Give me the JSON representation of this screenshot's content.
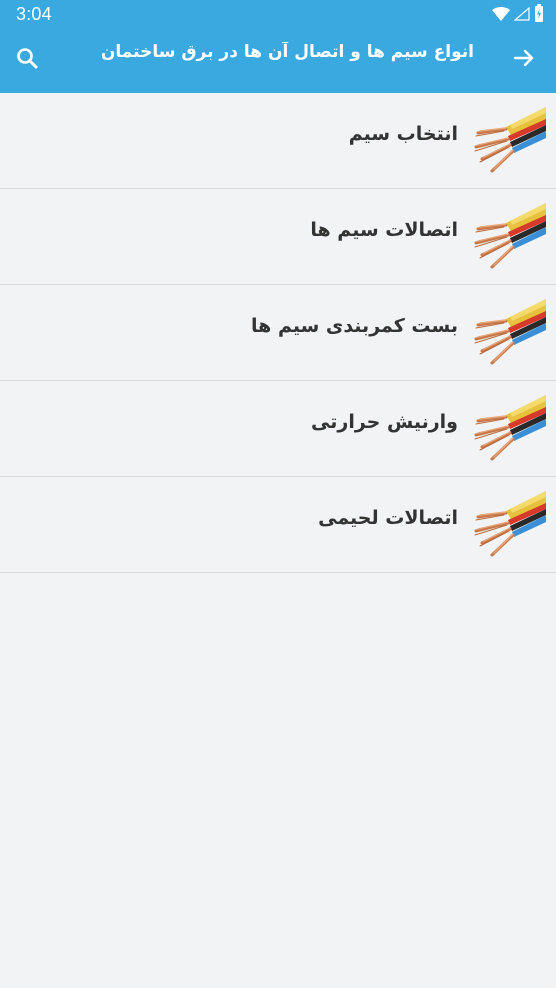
{
  "status_bar": {
    "time": "3:04",
    "icons": [
      "wifi-icon",
      "signal-icon",
      "battery-icon"
    ]
  },
  "toolbar": {
    "title": "انواع سیم ها و اتصال آن ها در برق ساختمان",
    "search_icon": "search-icon",
    "back_icon": "arrow-right-icon"
  },
  "list": {
    "items": [
      {
        "label": "انتخاب سیم",
        "thumbnail": "wire-cable-image"
      },
      {
        "label": "اتصالات سیم ها",
        "thumbnail": "wire-cable-image"
      },
      {
        "label": "بست کمربندی سیم ها",
        "thumbnail": "wire-cable-image"
      },
      {
        "label": "وارنیش حرارتی",
        "thumbnail": "wire-cable-image"
      },
      {
        "label": "اتصالات لحیمی",
        "thumbnail": "wire-cable-image"
      }
    ]
  },
  "colors": {
    "app_bar": "#3aa9e0",
    "background": "#f2f3f5",
    "divider": "#d8d9dc",
    "item_text": "#333333"
  }
}
